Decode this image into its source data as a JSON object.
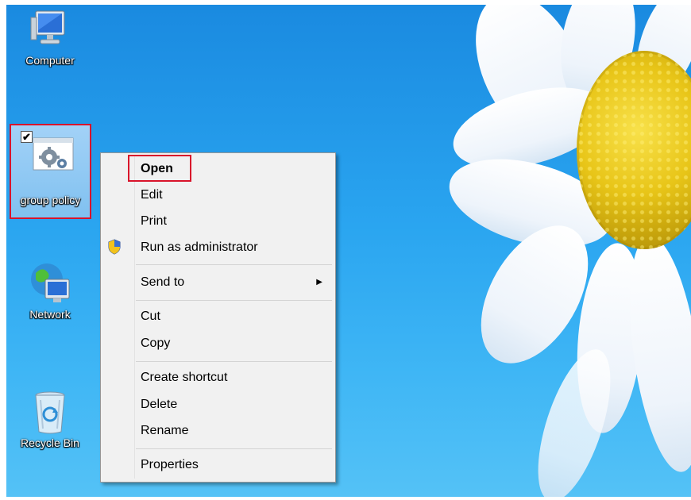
{
  "desktop": {
    "icons": [
      {
        "label": "Computer",
        "icon": "computer-icon"
      },
      {
        "label": "group policy",
        "icon": "gear-document-icon",
        "selected": true,
        "checked": true
      },
      {
        "label": "Network",
        "icon": "network-icon"
      },
      {
        "label": "Recycle Bin",
        "icon": "recycle-bin-icon"
      }
    ]
  },
  "context_menu": {
    "items": [
      {
        "label": "Open",
        "bold": true
      },
      {
        "label": "Edit"
      },
      {
        "label": "Print"
      },
      {
        "label": "Run as administrator",
        "icon": "uac-shield-icon"
      },
      {
        "label": "Send to",
        "submenu": true
      },
      {
        "label": "Cut"
      },
      {
        "label": "Copy"
      },
      {
        "label": "Create shortcut"
      },
      {
        "label": "Delete"
      },
      {
        "label": "Rename"
      },
      {
        "label": "Properties"
      }
    ]
  },
  "colors": {
    "highlight_box": "#d9142b",
    "menu_bg": "#f1f1f1",
    "desktop_blue": "#2aa5f0"
  }
}
